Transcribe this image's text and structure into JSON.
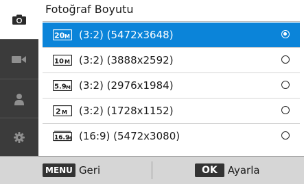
{
  "sidebar": {
    "tabs": [
      {
        "icon": "camera-icon",
        "active": true
      },
      {
        "icon": "video-camera-icon",
        "active": false
      },
      {
        "icon": "person-icon",
        "active": false
      },
      {
        "icon": "gear-icon",
        "active": false
      }
    ]
  },
  "menu": {
    "title": "Fotoğraf Boyutu",
    "options": [
      {
        "badge_icon": "size-20m-icon",
        "label": "(3:2) (5472x3648)",
        "selected": true
      },
      {
        "badge_icon": "size-10-1m-icon",
        "label": "(3:2) (3888x2592)",
        "selected": false
      },
      {
        "badge_icon": "size-5-9m-icon",
        "label": "(3:2) (2976x1984)",
        "selected": false
      },
      {
        "badge_icon": "size-2m-icon",
        "label": "(3:2) (1728x1152)",
        "selected": false
      },
      {
        "badge_icon": "size-16-9m-icon",
        "label": "(16:9) (5472x3080)",
        "selected": false
      }
    ]
  },
  "footer": {
    "back_key": "MENU",
    "back_label": "Geri",
    "ok_key": "OK",
    "ok_label": "Ayarla"
  },
  "colors": {
    "selected_row": "#0b84d9",
    "sidebar_bg": "#3b3b3b",
    "footer_bg": "#d6d6d6"
  }
}
